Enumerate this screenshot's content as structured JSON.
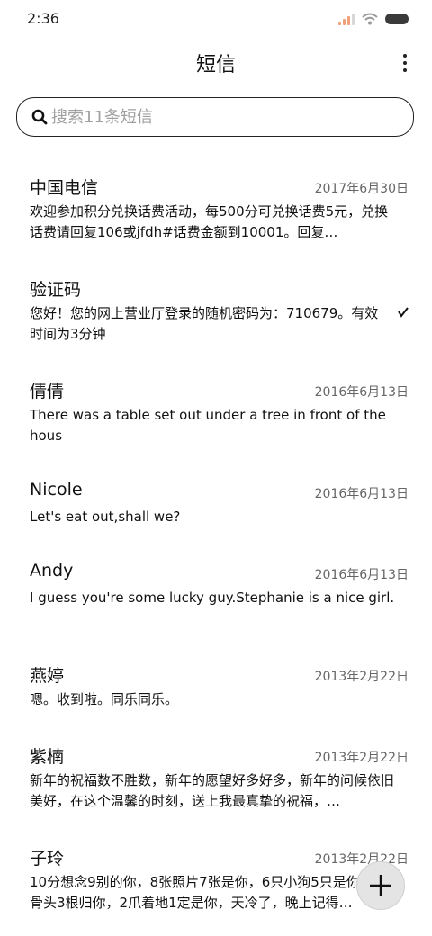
{
  "status_bar": {
    "time": "2:36",
    "icons": [
      "signal-icon",
      "wifi-icon",
      "battery-icon"
    ]
  },
  "header": {
    "title": "短信",
    "more_icon": "more-vertical-icon"
  },
  "search": {
    "placeholder": "搜索11条短信",
    "icon": "search-icon"
  },
  "messages": [
    {
      "sender": "中国电信",
      "date": "2017年6月30日",
      "preview": "欢迎参加积分兑换话费活动，每500分可兑换话费5元，兑换话费请回复106或jfdh#话费金额到10001。回复…"
    },
    {
      "sender": "验证码",
      "date": "",
      "preview": "您好！您的网上营业厅登录的随机密码为：710679。有效时间为3分钟",
      "status_icon": "draft-check-icon"
    },
    {
      "sender": "倩倩",
      "date": "2016年6月13日",
      "preview": "There was a table set out under a tree in front of the hous"
    },
    {
      "sender": "Nicole",
      "date": "2016年6月13日",
      "preview": "Let's eat out,shall we?"
    },
    {
      "sender": "Andy",
      "date": "2016年6月13日",
      "preview": "I guess you're some lucky guy.Stephanie is a nice girl."
    },
    {
      "sender": "燕婷",
      "date": "2013年2月22日",
      "preview": "嗯。收到啦。同乐同乐。"
    },
    {
      "sender": "紫楠",
      "date": "2013年2月22日",
      "preview": "新年的祝福数不胜数，新年的愿望好多好多，新年的问候依旧美好，在这个温馨的时刻，送上我最真挚的祝福，…"
    },
    {
      "sender": "子玲",
      "date": "2013年2月22日",
      "preview": "10分想念9别的你，8张照片7张是你，6只小狗5只是你，4根骨头3根归你，2爪着地1定是你，天冷了，晚上记得…"
    }
  ],
  "fab": {
    "icon": "plus-icon"
  },
  "colors": {
    "accent": "#222222",
    "date": "#666666",
    "placeholder": "#a0a0a0",
    "fab_bg": "#e4e4e4"
  }
}
